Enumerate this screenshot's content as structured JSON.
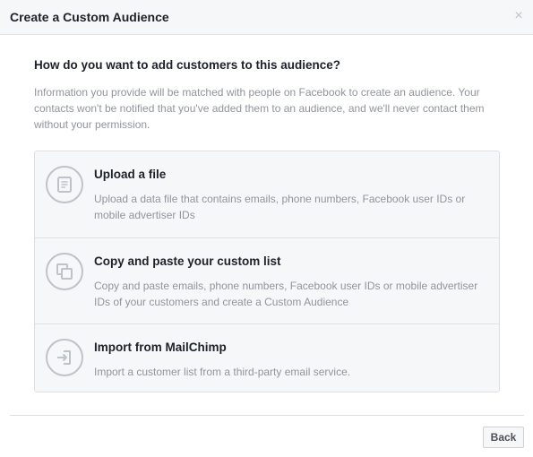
{
  "header": {
    "title": "Create a Custom Audience",
    "close_icon": "close-icon",
    "close_glyph": "×"
  },
  "main": {
    "question": "How do you want to add customers to this audience?",
    "description": "Information you provide will be matched with people on Facebook to create an audience. Your contacts won't be notified that you've added them to an audience, and we'll never contact them without your permission.",
    "options": [
      {
        "title": "Upload a file",
        "description": "Upload a data file that contains emails, phone numbers, Facebook user IDs or mobile advertiser IDs",
        "icon": "file-icon"
      },
      {
        "title": "Copy and paste your custom list",
        "description": "Copy and paste emails, phone numbers, Facebook user IDs or mobile advertiser IDs of your customers and create a Custom Audience",
        "icon": "copy-icon"
      },
      {
        "title": "Import from MailChimp",
        "description": "Import a customer list from a third-party email service.",
        "icon": "import-icon"
      }
    ]
  },
  "footer": {
    "back_label": "Back"
  },
  "colors": {
    "header_bg": "#f6f7f9",
    "text_primary": "#1d2129",
    "text_secondary": "#90949c",
    "border": "#dddfe2",
    "icon": "#bec2c9"
  }
}
